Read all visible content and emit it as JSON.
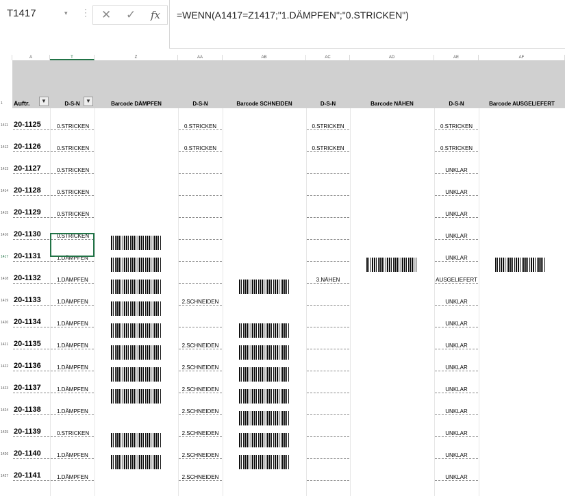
{
  "namebox": {
    "value": "T1417",
    "dropdown": "▾"
  },
  "formula_buttons": {
    "cancel": "✕",
    "enter": "✓",
    "fx": "fx",
    "dots": "⋮"
  },
  "formula": "=WENN(A1417=Z1417;\"1.DÄMPFEN\";\"0.STRICKEN\")",
  "columns": [
    "A",
    "T",
    "Z",
    "AA",
    "AB",
    "AC",
    "AD",
    "AE",
    "AF"
  ],
  "header_row_num": "1",
  "headers": [
    "Auftr.",
    "D-S-N",
    "Barcode DÄMPFEN",
    "D-S-N",
    "Barcode SCHNEIDEN",
    "D-S-N",
    "Barcode NÄHEN",
    "D-S-N",
    "Barcode AUSGELIEFERT"
  ],
  "filter_icon": "▼",
  "rows": [
    {
      "num": "1411",
      "order": "20-1125",
      "t": "0.STRICKEN",
      "z": false,
      "aa": "0.STRICKEN",
      "ab": false,
      "ac": "0.STRICKEN",
      "ad": false,
      "ae": "0.STRICKEN",
      "af": false
    },
    {
      "num": "1412",
      "order": "20-1126",
      "t": "0.STRICKEN",
      "z": false,
      "aa": "0.STRICKEN",
      "ab": false,
      "ac": "0.STRICKEN",
      "ad": false,
      "ae": "0.STRICKEN",
      "af": false
    },
    {
      "num": "1413",
      "order": "20-1127",
      "t": "0.STRICKEN",
      "z": false,
      "aa": "",
      "ab": false,
      "ac": "",
      "ad": false,
      "ae": "UNKLAR",
      "af": false
    },
    {
      "num": "1414",
      "order": "20-1128",
      "t": "0.STRICKEN",
      "z": false,
      "aa": "",
      "ab": false,
      "ac": "",
      "ad": false,
      "ae": "UNKLAR",
      "af": false
    },
    {
      "num": "1415",
      "order": "20-1129",
      "t": "0.STRICKEN",
      "z": false,
      "aa": "",
      "ab": false,
      "ac": "",
      "ad": false,
      "ae": "UNKLAR",
      "af": false
    },
    {
      "num": "1416",
      "order": "20-1130",
      "t": "0.STRICKEN",
      "z": false,
      "aa": "",
      "ab": false,
      "ac": "",
      "ad": false,
      "ae": "UNKLAR",
      "af": false
    },
    {
      "num": "1417",
      "order": "20-1131",
      "t": "1.DÄMPFEN",
      "z": true,
      "aa": "",
      "ab": false,
      "ac": "",
      "ad": false,
      "ae": "UNKLAR",
      "af": false
    },
    {
      "num": "1418",
      "order": "20-1132",
      "t": "1.DÄMPFEN",
      "z": true,
      "aa": "",
      "ab": false,
      "ac": "3.NÄHEN",
      "ad": true,
      "ae": "AUSGELIEFERT",
      "af": true
    },
    {
      "num": "1419",
      "order": "20-1133",
      "t": "1.DÄMPFEN",
      "z": true,
      "aa": "2.SCHNEIDEN",
      "ab": true,
      "ac": "",
      "ad": false,
      "ae": "UNKLAR",
      "af": false
    },
    {
      "num": "1420",
      "order": "20-1134",
      "t": "1.DÄMPFEN",
      "z": true,
      "aa": "",
      "ab": false,
      "ac": "",
      "ad": false,
      "ae": "UNKLAR",
      "af": false
    },
    {
      "num": "1421",
      "order": "20-1135",
      "t": "1.DÄMPFEN",
      "z": true,
      "aa": "2.SCHNEIDEN",
      "ab": true,
      "ac": "",
      "ad": false,
      "ae": "UNKLAR",
      "af": false
    },
    {
      "num": "1422",
      "order": "20-1136",
      "t": "1.DÄMPFEN",
      "z": true,
      "aa": "2.SCHNEIDEN",
      "ab": true,
      "ac": "",
      "ad": false,
      "ae": "UNKLAR",
      "af": false
    },
    {
      "num": "1423",
      "order": "20-1137",
      "t": "1.DÄMPFEN",
      "z": true,
      "aa": "2.SCHNEIDEN",
      "ab": true,
      "ac": "",
      "ad": false,
      "ae": "UNKLAR",
      "af": false
    },
    {
      "num": "1424",
      "order": "20-1138",
      "t": "1.DÄMPFEN",
      "z": true,
      "aa": "2.SCHNEIDEN",
      "ab": true,
      "ac": "",
      "ad": false,
      "ae": "UNKLAR",
      "af": false
    },
    {
      "num": "1425",
      "order": "20-1139",
      "t": "0.STRICKEN",
      "z": false,
      "aa": "2.SCHNEIDEN",
      "ab": true,
      "ac": "",
      "ad": false,
      "ae": "UNKLAR",
      "af": false
    },
    {
      "num": "1426",
      "order": "20-1140",
      "t": "1.DÄMPFEN",
      "z": true,
      "aa": "2.SCHNEIDEN",
      "ab": true,
      "ac": "",
      "ad": false,
      "ae": "UNKLAR",
      "af": false
    },
    {
      "num": "1427",
      "order": "20-1141",
      "t": "1.DÄMPFEN",
      "z": true,
      "aa": "2.SCHNEIDEN",
      "ab": true,
      "ac": "",
      "ad": false,
      "ae": "UNKLAR",
      "af": false
    }
  ],
  "selected_row": "1417",
  "colors": {
    "selection": "#217346",
    "header_bg": "#d0d0d0"
  }
}
